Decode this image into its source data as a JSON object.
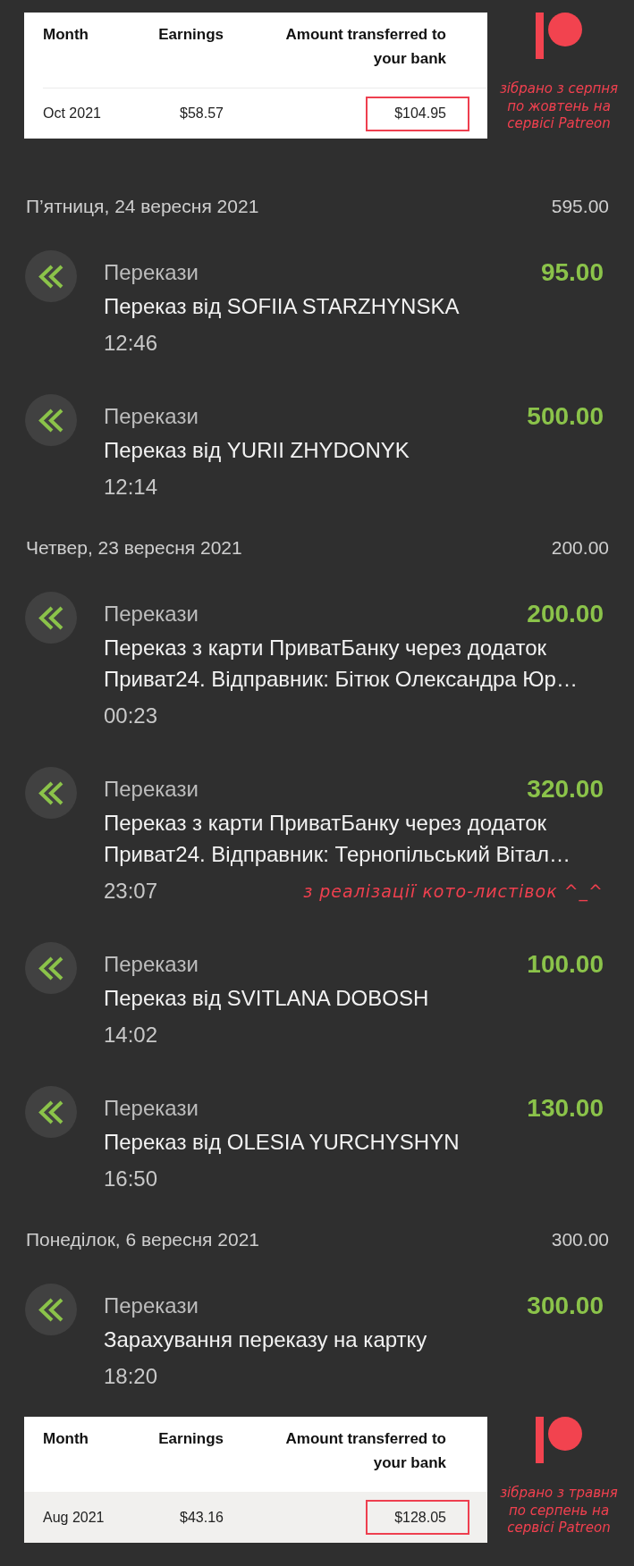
{
  "patreon_report_top": {
    "columns": [
      "Month",
      "Earnings",
      "Amount transferred to your bank"
    ],
    "rows": [
      {
        "month": "Oct 2021",
        "earnings": "$58.57",
        "transferred": "$104.95",
        "shaded": false,
        "boxed": true
      }
    ],
    "note": "зібрано з серпня по жовтень на сервісі Patreon"
  },
  "statement": {
    "days": [
      {
        "date": "П’ятниця, 24 вересня 2021",
        "total": "595.00",
        "transactions": [
          {
            "category": "Перекази",
            "description": "Переказ від SOFIIA STARZHYNSKA",
            "time": "12:46",
            "amount": "95.00"
          },
          {
            "category": "Перекази",
            "description": "Переказ від YURII ZHYDONYK",
            "time": "12:14",
            "amount": "500.00"
          }
        ]
      },
      {
        "date": "Четвер, 23 вересня 2021",
        "total": "200.00",
        "transactions": [
          {
            "category": "Перекази",
            "description": "Переказ з карти ПриватБанку через додаток Приват24. Відправник: Бітюк Олександра Юр…",
            "time": "00:23",
            "amount": "200.00"
          },
          {
            "category": "Перекази",
            "description": "Переказ з карти ПриватБанку через додаток Приват24. Відправник: Тернопільський Вітал…",
            "time": "23:07",
            "amount": "320.00",
            "note": "з реалізації кото-листівок ^_^"
          },
          {
            "category": "Перекази",
            "description": "Переказ від SVITLANA DOBOSH",
            "time": "14:02",
            "amount": "100.00"
          },
          {
            "category": "Перекази",
            "description": "Переказ від OLESIA YURCHYSHYN",
            "time": "16:50",
            "amount": "130.00"
          }
        ]
      },
      {
        "date": "Понеділок, 6 вересня 2021",
        "total": "300.00",
        "transactions": [
          {
            "category": "Перекази",
            "description": "Зарахування переказу на картку",
            "time": "18:20",
            "amount": "300.00"
          }
        ]
      }
    ]
  },
  "patreon_report_bottom": {
    "columns": [
      "Month",
      "Earnings",
      "Amount transferred to your bank"
    ],
    "rows": [
      {
        "month": "Aug 2021",
        "earnings": "$43.16",
        "transferred": "$128.05",
        "shaded": true,
        "boxed": true
      }
    ],
    "note": "зібрано з травня по серпень на сервісі Patreon"
  }
}
